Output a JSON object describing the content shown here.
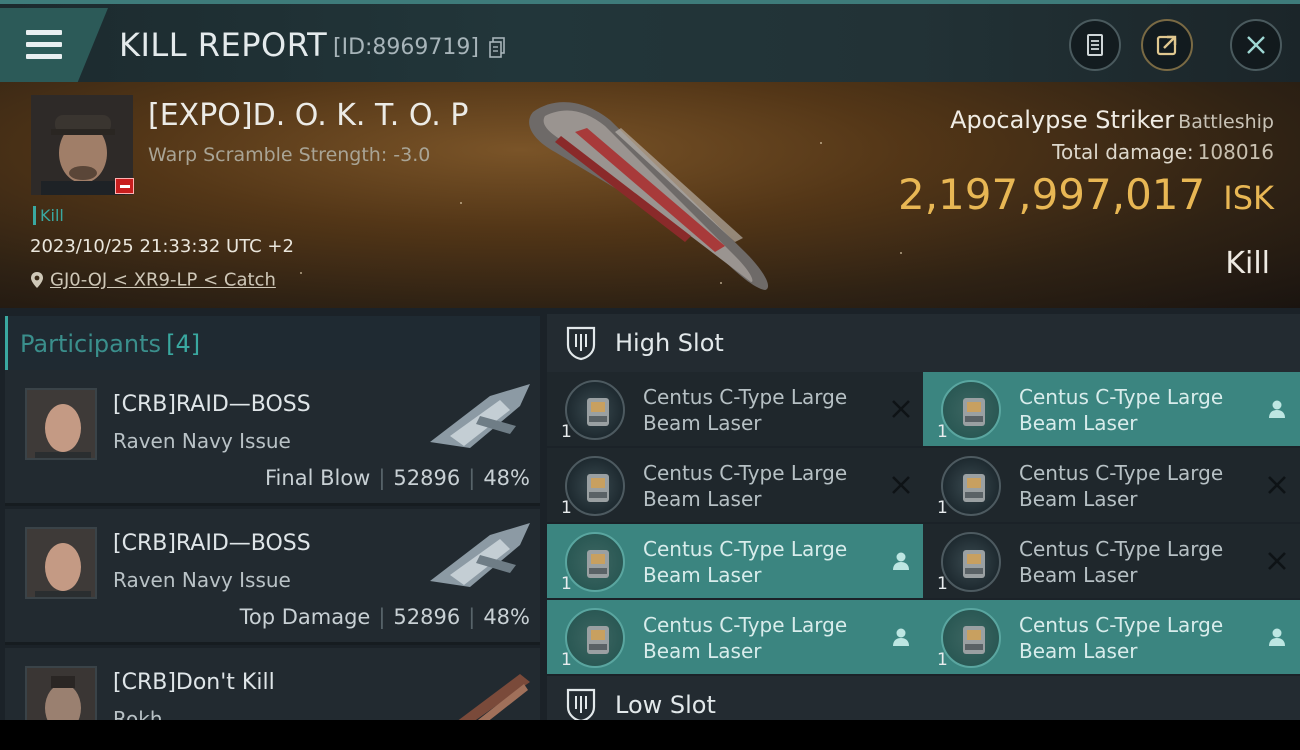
{
  "header": {
    "title": "KILL REPORT",
    "id_label": "[ID:8969719]"
  },
  "victim": {
    "name": "[EXPO]D. O. K. T. O. P",
    "warp": "Warp Scramble Strength: -3.0",
    "tag": "Kill",
    "time": "2023/10/25 21:33:32 UTC +2",
    "location": "GJ0-OJ < XR9-LP < Catch",
    "ship": "Apocalypse Striker",
    "ship_class": "Battleship",
    "total_damage_label": "Total damage:",
    "total_damage": "108016",
    "isk_value": "2,197,997,017",
    "isk_unit": "ISK",
    "kill_type": "Kill"
  },
  "participants": {
    "label": "Participants",
    "count": "[4]",
    "rows": [
      {
        "name": "[CRB]RAID—BOSS",
        "ship": "Raven Navy Issue",
        "role": "Final Blow",
        "damage": "52896",
        "percent": "48%"
      },
      {
        "name": "[CRB]RAID—BOSS",
        "ship": "Raven Navy Issue",
        "role": "Top Damage",
        "damage": "52896",
        "percent": "48%"
      },
      {
        "name": "[CRB]Don't Kill",
        "ship": "Rokh"
      }
    ]
  },
  "slots": {
    "high_label": "High Slot",
    "low_label": "Low Slot",
    "items": [
      {
        "line1": "Centus C-Type Large",
        "line2": "Beam Laser",
        "qty": "1",
        "state": "destroyed"
      },
      {
        "line1": "Centus C-Type Large",
        "line2": "Beam Laser",
        "qty": "1",
        "state": "dropped"
      },
      {
        "line1": "Centus C-Type Large",
        "line2": "Beam Laser",
        "qty": "1",
        "state": "destroyed"
      },
      {
        "line1": "Centus C-Type Large",
        "line2": "Beam Laser",
        "qty": "1",
        "state": "destroyed"
      },
      {
        "line1": "Centus C-Type Large",
        "line2": "Beam Laser",
        "qty": "1",
        "state": "dropped"
      },
      {
        "line1": "Centus C-Type Large",
        "line2": "Beam Laser",
        "qty": "1",
        "state": "destroyed"
      },
      {
        "line1": "Centus C-Type Large",
        "line2": "Beam Laser",
        "qty": "1",
        "state": "dropped"
      },
      {
        "line1": "Centus C-Type Large",
        "line2": "Beam Laser",
        "qty": "1",
        "state": "dropped"
      }
    ]
  },
  "icons": {
    "menu": "menu-icon",
    "copy": "copy-icon",
    "clipboard": "clipboard-icon",
    "share": "share-icon",
    "close": "close-icon",
    "location": "location-pin-icon",
    "slot": "slot-shield-icon",
    "destroyed": "x-icon",
    "dropped": "person-icon"
  },
  "colors": {
    "accent": "#3aa8a0",
    "isk": "#e8b754",
    "dropped_bg": "#3b8580"
  }
}
